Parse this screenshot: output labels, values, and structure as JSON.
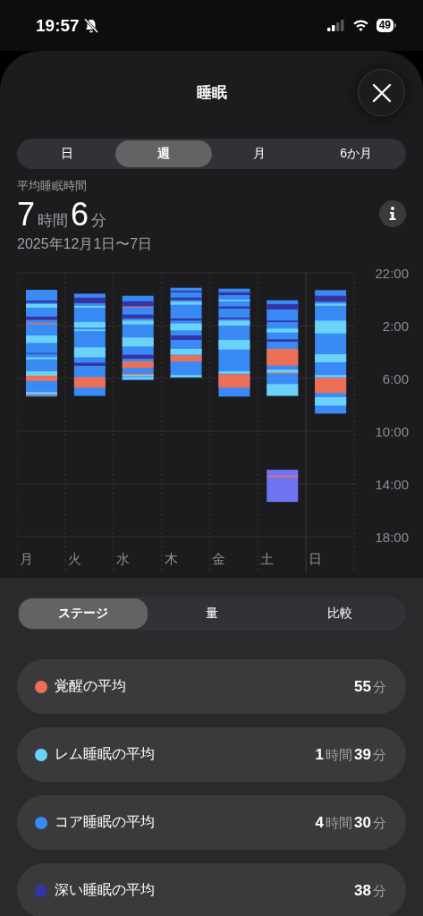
{
  "status_bar": {
    "time": "19:57",
    "battery": "49"
  },
  "header": {
    "title": "睡眠"
  },
  "range_tabs": [
    {
      "label": "日",
      "selected": false
    },
    {
      "label": "週",
      "selected": true
    },
    {
      "label": "月",
      "selected": false
    },
    {
      "label": "6か月",
      "selected": false
    }
  ],
  "summary": {
    "label": "平均睡眠時間",
    "value": "**7**時間**6**分",
    "date_range": "2025年12月1日〜7日"
  },
  "sleep_chart": {
    "y_labels": [
      "22:00",
      "2:00",
      "6:00",
      "10:00",
      "14:00",
      "18:00"
    ],
    "day_labels": [
      "月",
      "火",
      "水",
      "木",
      "金",
      "土",
      "日"
    ]
  },
  "view_tabs": [
    {
      "label": "ステージ",
      "selected": true
    },
    {
      "label": "量",
      "selected": false
    },
    {
      "label": "比較",
      "selected": false
    }
  ],
  "stages": [
    {
      "label": "覚醒の平均",
      "value": "**55**分",
      "color": "#ec6f56"
    },
    {
      "label": "レム睡眠の平均",
      "value": "**1**時間**39**分",
      "color": "#6bd2fa"
    },
    {
      "label": "コア睡眠の平均",
      "value": "**4**時間**30**分",
      "color": "#3a8af5"
    },
    {
      "label": "深い睡眠の平均",
      "value": "**38**分",
      "color": "#3634a3"
    }
  ]
}
